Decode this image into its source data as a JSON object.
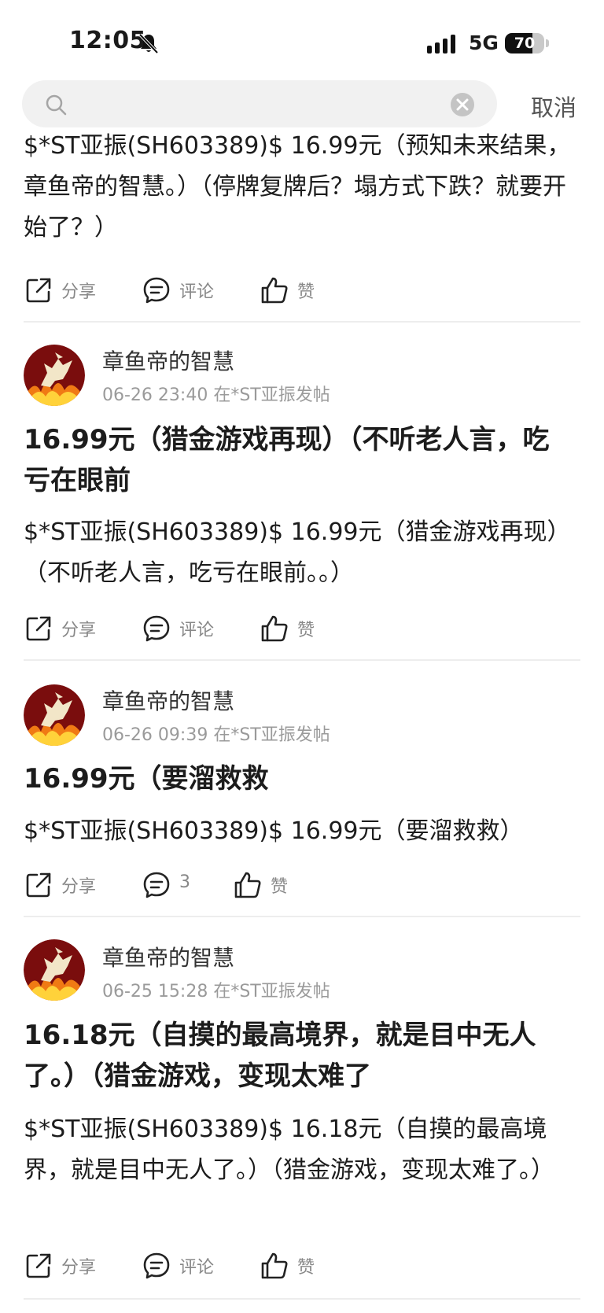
{
  "status": {
    "time": "12:05",
    "network": "5G",
    "battery": "70",
    "battery_level": 0.7
  },
  "search": {
    "placeholder": "",
    "cancel_label": "取消"
  },
  "posts": [
    {
      "body": "$*ST亚振(SH603389)$ 16.99元（预知未来结果，章鱼帝的智慧。）（停牌复牌后？塌方式下跌？就要开始了？）",
      "actions": {
        "share": "分享",
        "comment": "评论",
        "like": "赞"
      }
    },
    {
      "author": "章鱼帝的智慧",
      "meta": "06-26 23:40  在*ST亚振发帖",
      "title": "16.99元（猎金游戏再现）（不听老人言，吃亏在眼前",
      "body": "$*ST亚振(SH603389)$ 16.99元（猎金游戏再现）（不听老人言，吃亏在眼前。。）",
      "actions": {
        "share": "分享",
        "comment": "评论",
        "like": "赞"
      }
    },
    {
      "author": "章鱼帝的智慧",
      "meta": "06-26 09:39  在*ST亚振发帖",
      "title": "16.99元（要溜救救",
      "body": "$*ST亚振(SH603389)$ 16.99元（要溜救救）",
      "actions": {
        "share": "分享",
        "comment": "3",
        "like": "赞"
      }
    },
    {
      "author": "章鱼帝的智慧",
      "meta": "06-25 15:28  在*ST亚振发帖",
      "title": "16.18元（自摸的最高境界，就是目中无人了。）（猎金游戏，变现太难了",
      "body": "$*ST亚振(SH603389)$ 16.18元（自摸的最高境界，就是目中无人了。）（猎金游戏，变现太难了。）",
      "actions": {
        "share": "分享",
        "comment": "评论",
        "like": "赞"
      }
    }
  ]
}
